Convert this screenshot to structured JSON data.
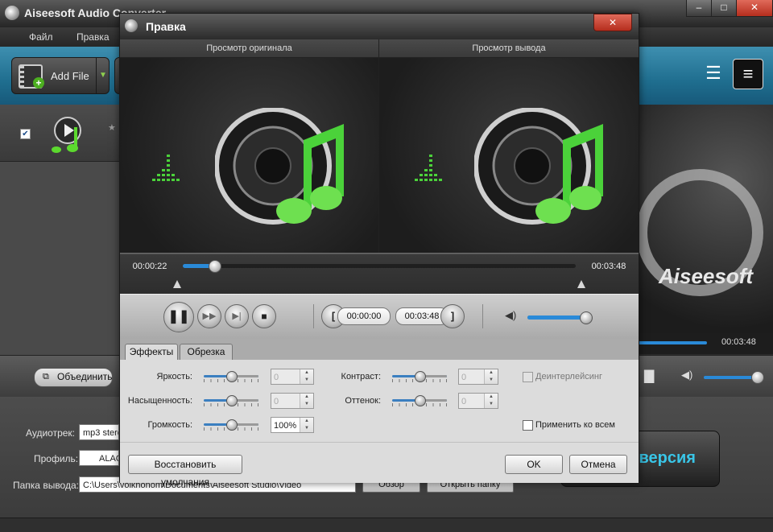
{
  "app": {
    "title": "Aiseesoft Audio Converter"
  },
  "menu": {
    "file": "Файл",
    "edit": "Правка"
  },
  "toolbar": {
    "add_file": "Add File"
  },
  "preview": {
    "time_end": "00:03:48",
    "logo_text": "Aiseesoft"
  },
  "bottom": {
    "merge": "Объединить"
  },
  "settings": {
    "audio_track_label": "Аудиотрек:",
    "audio_track_value": "mp3 stere",
    "profile_label": "Профиль:",
    "profile_value": "ALAC",
    "output_label": "Папка вывода:",
    "output_path": "C:\\Users\\volkhonom\\Documents\\Aiseesoft Studio\\Video",
    "browse": "Обзор",
    "open_folder": "Открыть папку",
    "convert": "Конверсия"
  },
  "dialog": {
    "title": "Правка",
    "close": "✕",
    "preview_original": "Просмотр оригинала",
    "preview_output": "Просмотр вывода",
    "time_current": "00:00:22",
    "time_total": "00:03:48",
    "progress": 0.08,
    "start_time": "00:00:00",
    "end_time": "00:03:48",
    "volume_level": 0.9,
    "tabs": [
      "Эффекты",
      "Обрезка"
    ],
    "active_tab": 0,
    "effects": {
      "brightness_label": "Яркость:",
      "saturation_label": "Насыщенность:",
      "volume_label": "Громкость:",
      "contrast_label": "Контраст:",
      "hue_label": "Оттенок:",
      "brightness_value": "0",
      "saturation_value": "0",
      "volume_value": "100%",
      "contrast_value": "0",
      "hue_value": "0",
      "deinterlace": "Деинтерлейсинг",
      "apply_all": "Применить ко всем"
    },
    "restore_defaults": "Восстановить умолчания",
    "ok": "OK",
    "cancel": "Отмена"
  },
  "colors": {
    "toolbar_blue": "#1f6e8f",
    "seek_blue": "#2a8ad8",
    "note_green": "#5cd92e",
    "close_red": "#c9402e"
  }
}
